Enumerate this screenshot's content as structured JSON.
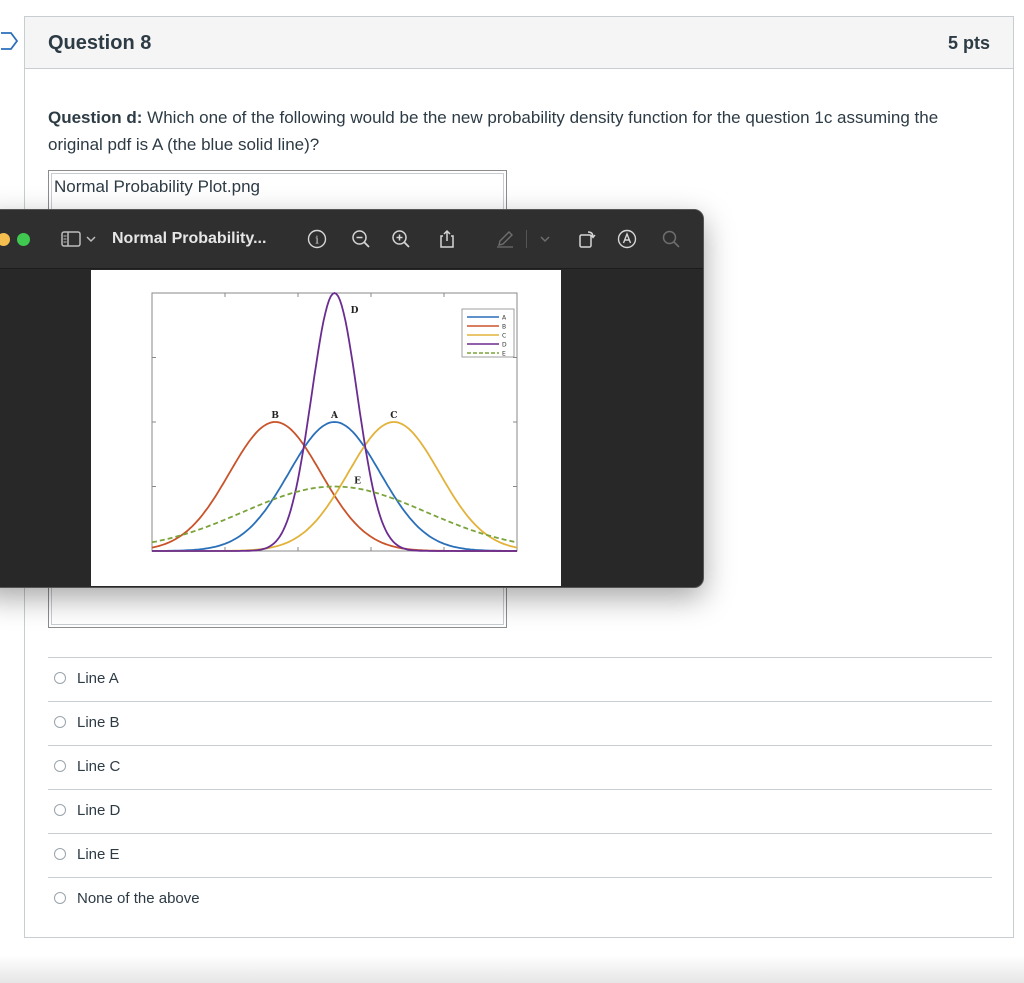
{
  "question": {
    "title": "Question 8",
    "points": "5 pts",
    "prompt_label": "Question d:",
    "prompt_text": " Which one of the following would be the new probability density function for the question 1c assuming the original pdf is A (the blue solid line)?",
    "image_filename": "Normal Probability Plot.png"
  },
  "answers": [
    {
      "label": "Line A"
    },
    {
      "label": "Line B"
    },
    {
      "label": "Line C"
    },
    {
      "label": "Line D"
    },
    {
      "label": "Line E"
    },
    {
      "label": "None of the above"
    }
  ],
  "preview_window": {
    "title": "Normal Probability...",
    "icons": [
      "sidebar-icon",
      "chevron-down-icon",
      "info-icon",
      "zoom-out-icon",
      "zoom-in-icon",
      "share-icon",
      "markup-pen-icon",
      "chevron-down-icon",
      "rotate-icon",
      "markup-icon",
      "search-icon"
    ]
  },
  "colors": {
    "A": "#2a6fba",
    "B": "#c9532a",
    "C": "#e2b23a",
    "D": "#6b2c91",
    "E": "#7aa33a"
  },
  "chart_data": {
    "type": "line",
    "title": "",
    "xlabel": "",
    "ylabel": "",
    "series": [
      {
        "name": "A",
        "mean": 0,
        "sd": 1,
        "peak_rel": 0.5,
        "style": "solid"
      },
      {
        "name": "B",
        "mean": -1.3,
        "sd": 1,
        "peak_rel": 0.5,
        "style": "solid"
      },
      {
        "name": "C",
        "mean": 1.3,
        "sd": 1,
        "peak_rel": 0.5,
        "style": "solid"
      },
      {
        "name": "D",
        "mean": 0,
        "sd": 0.5,
        "peak_rel": 1.0,
        "style": "solid"
      },
      {
        "name": "E",
        "mean": 0,
        "sd": 2,
        "peak_rel": 0.25,
        "style": "dashed"
      }
    ],
    "annotations": [
      "B",
      "A",
      "C",
      "D",
      "E"
    ],
    "legend": [
      "A",
      "B",
      "C",
      "D",
      "E"
    ],
    "legend_position": "top-right",
    "xlim": [
      -4,
      4
    ],
    "ylim": [
      0,
      1
    ]
  }
}
